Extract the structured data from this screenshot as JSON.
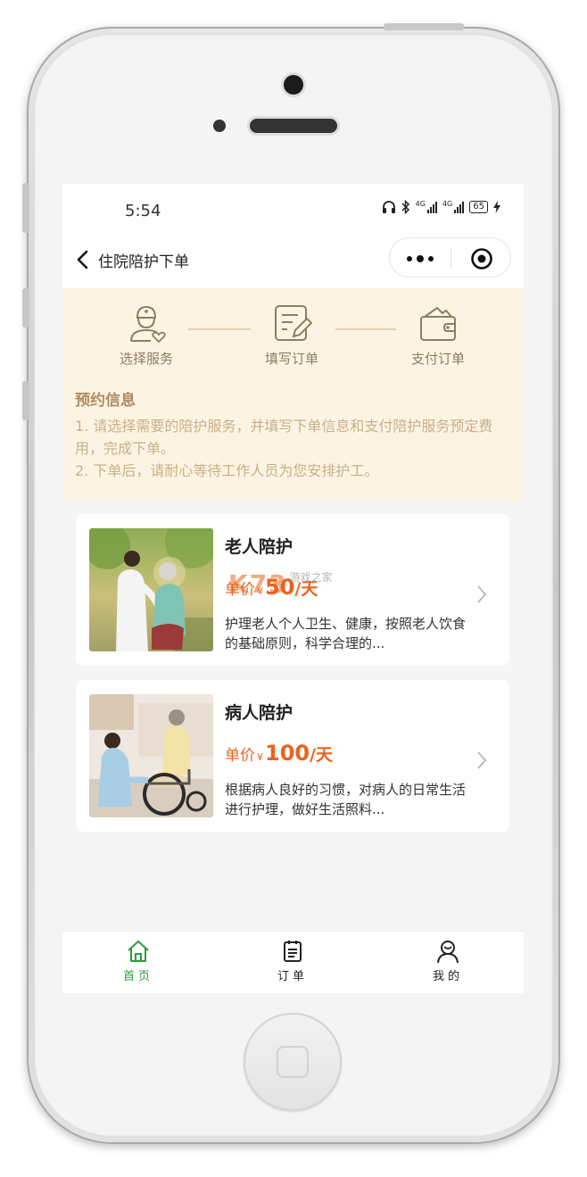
{
  "status_bar": {
    "time": "5:54",
    "network_1": "4G",
    "network_2": "4G",
    "battery": "65"
  },
  "nav": {
    "title": "住院陪护下单"
  },
  "steps": [
    {
      "label": "选择服务",
      "icon": "nurse-icon"
    },
    {
      "label": "填写订单",
      "icon": "edit-form-icon"
    },
    {
      "label": "支付订单",
      "icon": "wallet-icon"
    }
  ],
  "info": {
    "title": "预约信息",
    "line1": "1. 请选择需要的陪护服务，并填写下单信息和支付陪护服务预定费用，完成下单。",
    "line2": "2. 下单后，请耐心等待工作人员为您安排护工。"
  },
  "services": [
    {
      "title": "老人陪护",
      "price_label": "单价",
      "currency": "¥",
      "price": "50",
      "unit": "/天",
      "desc": "护理老人个人卫生、健康，按照老人饮食的基础原则，科学合理的..."
    },
    {
      "title": "病人陪护",
      "price_label": "单价",
      "currency": "¥",
      "price": "100",
      "unit": "/天",
      "desc": "根据病人良好的习惯，对病人的日常生活进行护理，做好生活照料..."
    }
  ],
  "watermark": {
    "text": "K73",
    "sub": "游戏之家"
  },
  "tabs": [
    {
      "label": "首页",
      "icon": "home-icon",
      "active": true
    },
    {
      "label": "订单",
      "icon": "order-list-icon",
      "active": false
    },
    {
      "label": "我的",
      "icon": "user-icon",
      "active": false
    }
  ],
  "colors": {
    "accent": "#e8641e",
    "step_panel_bg": "#fcf4e3",
    "step_text": "#8e7d62",
    "info_title": "#b08c60",
    "info_text": "#c8b088",
    "tab_active": "#2e9a3c"
  }
}
